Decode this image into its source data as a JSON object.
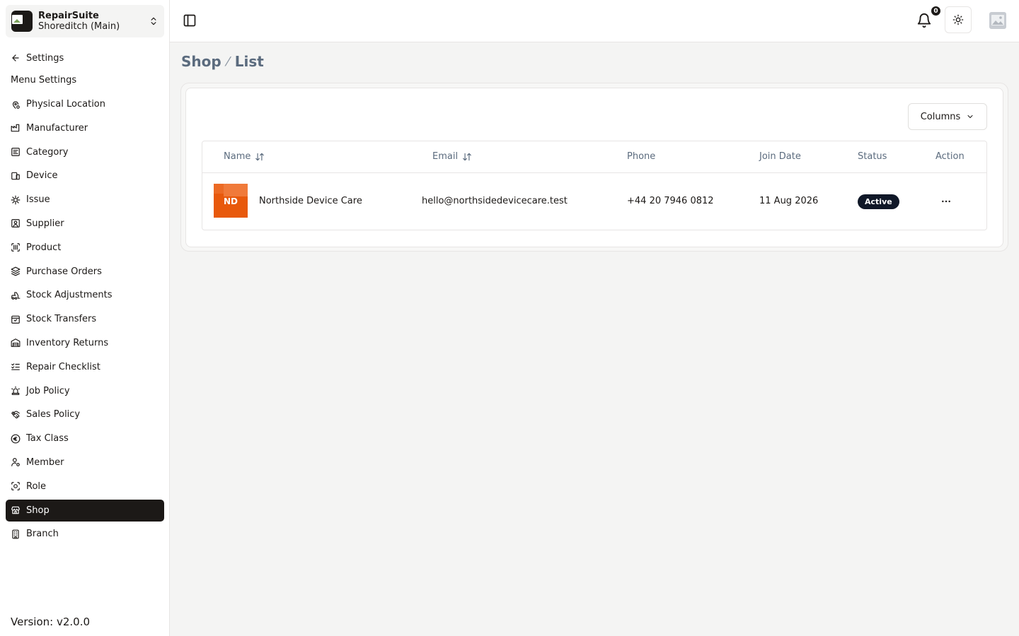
{
  "org": {
    "name": "RepairSuite",
    "branch": "Shoreditch (Main)"
  },
  "sidebar": {
    "back_label": "Settings",
    "menu_title": "Menu Settings",
    "items": [
      {
        "label": "Physical Location",
        "icon": "map-pin-icon"
      },
      {
        "label": "Manufacturer",
        "icon": "factory-icon"
      },
      {
        "label": "Category",
        "icon": "list-tree-icon"
      },
      {
        "label": "Device",
        "icon": "devices-icon"
      },
      {
        "label": "Issue",
        "icon": "bug-icon"
      },
      {
        "label": "Supplier",
        "icon": "contact-icon"
      },
      {
        "label": "Product",
        "icon": "scan-barcode-icon"
      },
      {
        "label": "Purchase Orders",
        "icon": "layers-icon"
      },
      {
        "label": "Stock Adjustments",
        "icon": "forklift-icon"
      },
      {
        "label": "Stock Transfers",
        "icon": "package-check-icon"
      },
      {
        "label": "Inventory Returns",
        "icon": "warehouse-icon"
      },
      {
        "label": "Repair Checklist",
        "icon": "list-checks-icon"
      },
      {
        "label": "Job Policy",
        "icon": "siren-icon"
      },
      {
        "label": "Sales Policy",
        "icon": "handshake-icon"
      },
      {
        "label": "Tax Class",
        "icon": "euro-icon"
      },
      {
        "label": "Member",
        "icon": "user-cog-icon"
      },
      {
        "label": "Role",
        "icon": "scan-face-icon"
      },
      {
        "label": "Shop",
        "icon": "store-icon",
        "active": true
      },
      {
        "label": "Branch",
        "icon": "building-icon"
      }
    ],
    "version": "Version: v2.0.0"
  },
  "topbar": {
    "notification_count": "0"
  },
  "breadcrumb": {
    "section": "Shop",
    "separator": "⁄",
    "page": "List"
  },
  "table": {
    "columns_button": "Columns",
    "headers": {
      "name": "Name",
      "email": "Email",
      "phone": "Phone",
      "join_date": "Join Date",
      "status": "Status",
      "action": "Action"
    },
    "rows": [
      {
        "logo_initials": "ND",
        "name": "Northside Device Care",
        "email": "hello@northsidedevicecare.test",
        "phone": "+44 20 7946 0812",
        "join_date": "11 Aug 2026",
        "status": "Active"
      }
    ]
  },
  "colors": {
    "accent": "#1c1917",
    "badge": "#101828",
    "logo": "#e8590c",
    "muted_text": "#5b6b7e"
  }
}
